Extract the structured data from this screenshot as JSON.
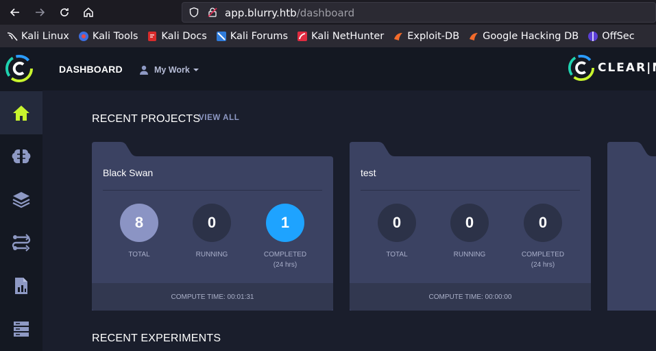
{
  "browser": {
    "url_host": "app.blurry.htb",
    "url_path": "/dashboard"
  },
  "bookmarks": [
    {
      "label": "Kali Linux",
      "icon": "kali-dragon-icon"
    },
    {
      "label": "Kali Tools",
      "icon": "kali-tools-icon"
    },
    {
      "label": "Kali Docs",
      "icon": "kali-docs-icon"
    },
    {
      "label": "Kali Forums",
      "icon": "kali-forums-icon"
    },
    {
      "label": "Kali NetHunter",
      "icon": "nethunter-icon"
    },
    {
      "label": "Exploit-DB",
      "icon": "exploit-db-icon"
    },
    {
      "label": "Google Hacking DB",
      "icon": "ghdb-icon"
    },
    {
      "label": "OffSec",
      "icon": "offsec-icon"
    }
  ],
  "header": {
    "title": "DASHBOARD",
    "my_work": "My Work",
    "brand": "CLEAR|ML"
  },
  "sidebar": {
    "items": [
      "home-icon",
      "brain-icon",
      "layers-icon",
      "pipelines-icon",
      "reports-icon",
      "datasets-icon"
    ]
  },
  "recent_projects": {
    "title": "RECENT PROJECTS",
    "view_all": "VIEW ALL",
    "cards": [
      {
        "name": "Black Swan",
        "total": "8",
        "total_label": "TOTAL",
        "running": "0",
        "running_label": "RUNNING",
        "completed": "1",
        "completed_label": "COMPLETED",
        "completed_sub": "(24 hrs)",
        "compute_time": "COMPUTE TIME: 00:01:31"
      },
      {
        "name": "test",
        "total": "0",
        "total_label": "TOTAL",
        "running": "0",
        "running_label": "RUNNING",
        "completed": "0",
        "completed_label": "COMPLETED",
        "completed_sub": "(24 hrs)",
        "compute_time": "COMPUTE TIME: 00:00:00"
      }
    ]
  },
  "recent_experiments": {
    "title": "RECENT EXPERIMENTS"
  },
  "colors": {
    "accent_green": "#c8f42e",
    "completed_blue": "#1ea3ff",
    "total_lilac": "#8b94c4",
    "card_bg": "#3b4262"
  }
}
